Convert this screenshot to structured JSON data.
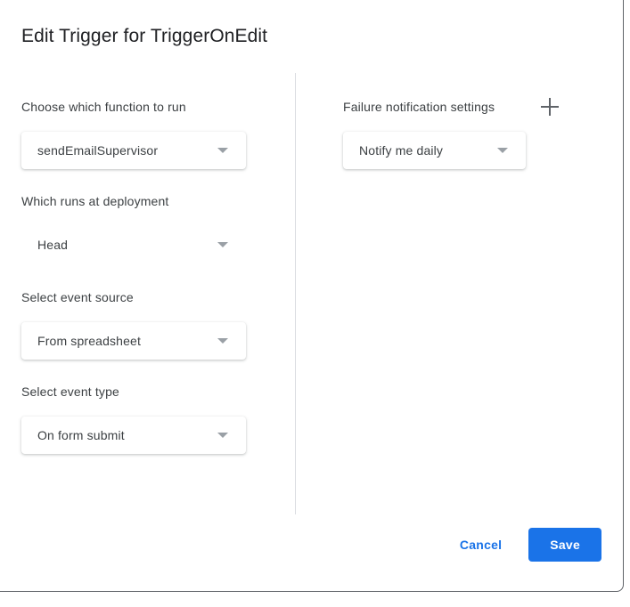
{
  "dialog": {
    "title": "Edit Trigger for TriggerOnEdit"
  },
  "left_column": {
    "fields": [
      {
        "label": "Choose which function to run",
        "value": "sendEmailSupervisor",
        "style": "boxed"
      },
      {
        "label": "Which runs at deployment",
        "value": "Head",
        "style": "flat"
      },
      {
        "label": "Select event source",
        "value": "From spreadsheet",
        "style": "boxed"
      },
      {
        "label": "Select event type",
        "value": "On form submit",
        "style": "boxed"
      }
    ]
  },
  "right_column": {
    "label": "Failure notification settings",
    "add_icon": "plus-icon",
    "field": {
      "value": "Notify me daily"
    }
  },
  "actions": {
    "cancel_label": "Cancel",
    "save_label": "Save"
  },
  "colors": {
    "accent": "#1a73e8",
    "text_primary": "#202124",
    "text_secondary": "#3c4043",
    "caret": "#9aa0a6",
    "divider": "#dadce0",
    "dialog_border": "#5f6368"
  }
}
